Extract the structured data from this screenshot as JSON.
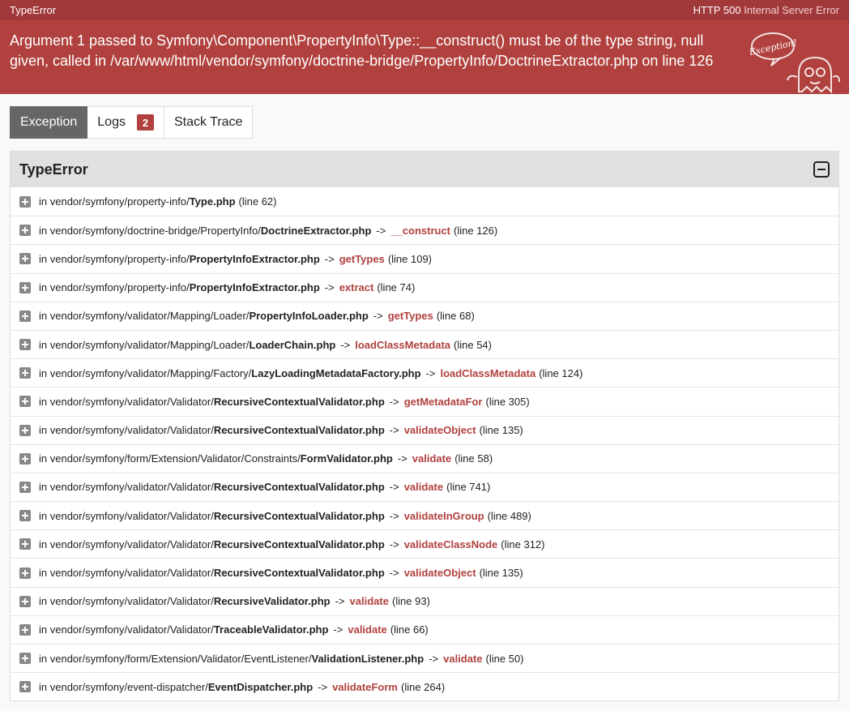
{
  "topbar": {
    "error_type": "TypeError",
    "status_code": "HTTP 500",
    "status_text": "Internal Server Error"
  },
  "header": {
    "message": "Argument 1 passed to Symfony\\Component\\PropertyInfo\\Type::__construct() must be of the type string, null given, called in /var/www/html/vendor/symfony/doctrine-bridge/PropertyInfo/DoctrineExtractor.php on line 126",
    "illustration_text": "Exception!"
  },
  "tabs": [
    {
      "label": "Exception",
      "active": true
    },
    {
      "label": "Logs",
      "badge": "2"
    },
    {
      "label": "Stack Trace"
    }
  ],
  "panel": {
    "title": "TypeError"
  },
  "trace": [
    {
      "prefix": "in vendor/symfony/property-info/",
      "file": "Type.php",
      "func": "",
      "line": "(line 62)"
    },
    {
      "prefix": "in vendor/symfony/doctrine-bridge/PropertyInfo/",
      "file": "DoctrineExtractor.php",
      "func": "__construct",
      "line": "(line 126)"
    },
    {
      "prefix": "in vendor/symfony/property-info/",
      "file": "PropertyInfoExtractor.php",
      "func": "getTypes",
      "line": "(line 109)"
    },
    {
      "prefix": "in vendor/symfony/property-info/",
      "file": "PropertyInfoExtractor.php",
      "func": "extract",
      "line": "(line 74)"
    },
    {
      "prefix": "in vendor/symfony/validator/Mapping/Loader/",
      "file": "PropertyInfoLoader.php",
      "func": "getTypes",
      "line": "(line 68)"
    },
    {
      "prefix": "in vendor/symfony/validator/Mapping/Loader/",
      "file": "LoaderChain.php",
      "func": "loadClassMetadata",
      "line": "(line 54)"
    },
    {
      "prefix": "in vendor/symfony/validator/Mapping/Factory/",
      "file": "LazyLoadingMetadataFactory.php",
      "func": "loadClassMetadata",
      "line": "(line 124)"
    },
    {
      "prefix": "in vendor/symfony/validator/Validator/",
      "file": "RecursiveContextualValidator.php",
      "func": "getMetadataFor",
      "line": "(line 305)"
    },
    {
      "prefix": "in vendor/symfony/validator/Validator/",
      "file": "RecursiveContextualValidator.php",
      "func": "validateObject",
      "line": "(line 135)"
    },
    {
      "prefix": "in vendor/symfony/form/Extension/Validator/Constraints/",
      "file": "FormValidator.php",
      "func": "validate",
      "line": "(line 58)"
    },
    {
      "prefix": "in vendor/symfony/validator/Validator/",
      "file": "RecursiveContextualValidator.php",
      "func": "validate",
      "line": "(line 741)"
    },
    {
      "prefix": "in vendor/symfony/validator/Validator/",
      "file": "RecursiveContextualValidator.php",
      "func": "validateInGroup",
      "line": "(line 489)"
    },
    {
      "prefix": "in vendor/symfony/validator/Validator/",
      "file": "RecursiveContextualValidator.php",
      "func": "validateClassNode",
      "line": "(line 312)"
    },
    {
      "prefix": "in vendor/symfony/validator/Validator/",
      "file": "RecursiveContextualValidator.php",
      "func": "validateObject",
      "line": "(line 135)"
    },
    {
      "prefix": "in vendor/symfony/validator/Validator/",
      "file": "RecursiveValidator.php",
      "func": "validate",
      "line": "(line 93)"
    },
    {
      "prefix": "in vendor/symfony/validator/Validator/",
      "file": "TraceableValidator.php",
      "func": "validate",
      "line": "(line 66)"
    },
    {
      "prefix": "in vendor/symfony/form/Extension/Validator/EventListener/",
      "file": "ValidationListener.php",
      "func": "validate",
      "line": "(line 50)"
    },
    {
      "prefix": "in vendor/symfony/event-dispatcher/",
      "file": "EventDispatcher.php",
      "func": "validateForm",
      "line": "(line 264)"
    }
  ],
  "icons": {
    "collapse": "minus-square-icon",
    "expand": "plus-square-icon",
    "mascot": "ghost-icon"
  },
  "colors": {
    "accent": "#b0413e",
    "topbar": "#a1383a",
    "active_tab": "#666666"
  }
}
